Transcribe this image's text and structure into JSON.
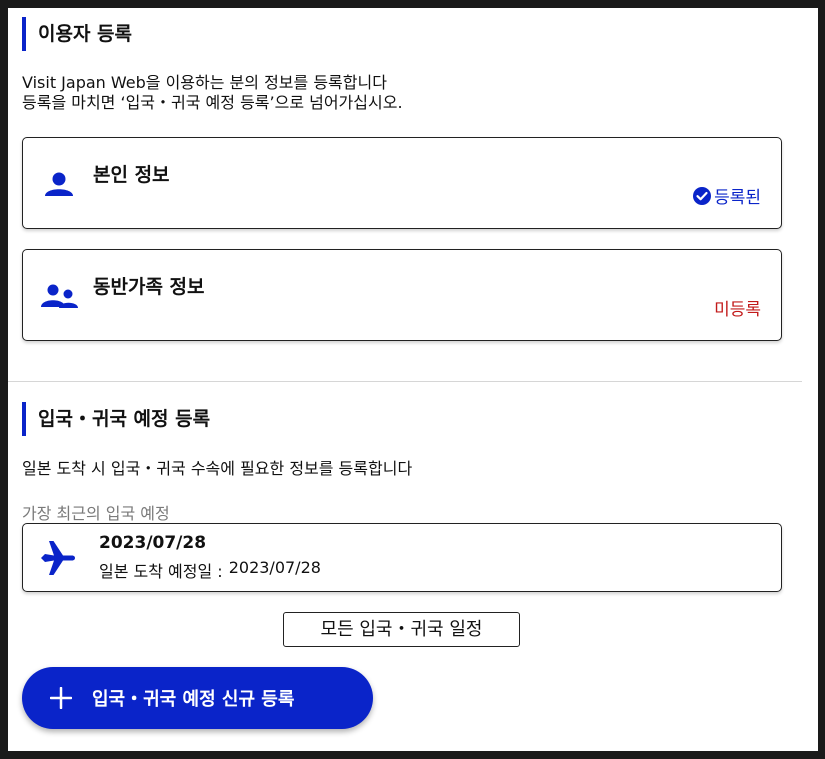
{
  "registration": {
    "title": "이용자 등록",
    "desc_line1": "Visit Japan Web을 이용하는 분의 정보를 등록합니다",
    "desc_line2": "등록을 마치면 ‘입국・귀국 예정 등록’으로 넘어가십시오.",
    "cards": [
      {
        "title": "본인 정보",
        "status": "등록된",
        "icon": "person-icon",
        "status_color": "#0a24c9"
      },
      {
        "title": "동반가족 정보",
        "status": "미등록",
        "icon": "family-icon",
        "status_color": "#c21a1a"
      }
    ]
  },
  "schedule": {
    "title": "입국・귀국 예정 등록",
    "desc": "일본 도착 시 입국・귀국 수속에 필요한 정보를 등록합니다",
    "latest_label": "가장 최근의 입국 예정",
    "trip": {
      "date": "2023/07/28",
      "arrival_label": "일본 도착 예정일 :",
      "arrival_date": "2023/07/28",
      "icon": "airplane-icon"
    },
    "all_button": "모든 입국・귀국 일정",
    "new_button": "입국・귀국 예정 신규 등록"
  },
  "colors": {
    "accent": "#0a24c9",
    "unregistered": "#c21a1a"
  }
}
